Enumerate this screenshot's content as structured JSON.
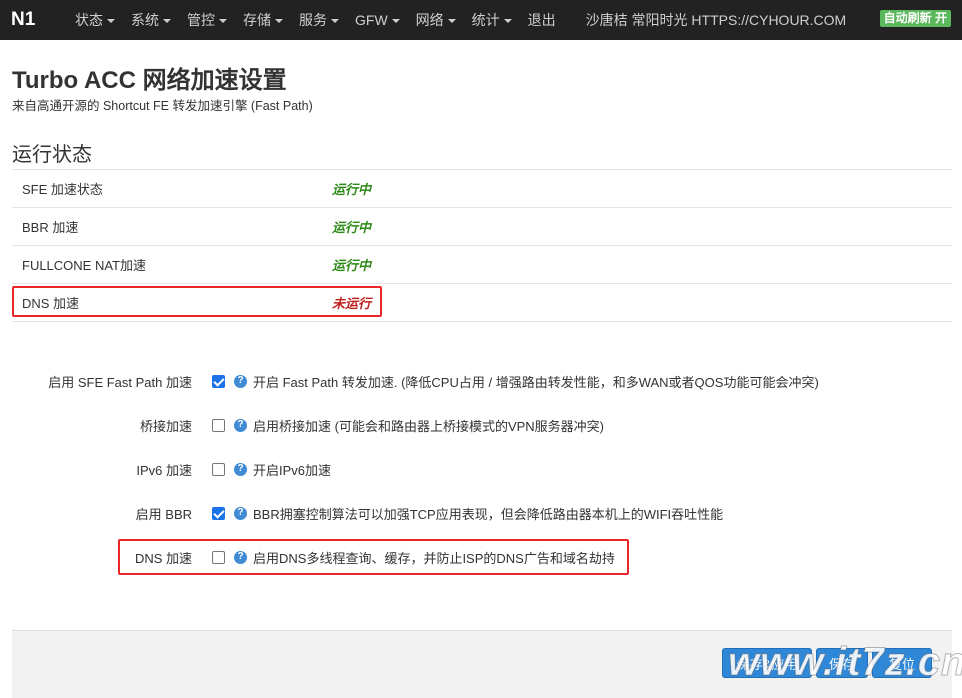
{
  "navbar": {
    "brand": "N1",
    "menu": [
      {
        "label": "状态"
      },
      {
        "label": "系统"
      },
      {
        "label": "管控"
      },
      {
        "label": "存储"
      },
      {
        "label": "服务"
      },
      {
        "label": "GFW"
      },
      {
        "label": "网络"
      },
      {
        "label": "统计"
      },
      {
        "label": "退出"
      }
    ],
    "host": "沙唐桔 常阳时光 HTTPS://CYHOUR.COM",
    "auto_refresh": "自动刷新 开",
    "accent_color": "#5cb85c"
  },
  "page": {
    "title": "Turbo ACC 网络加速设置",
    "description": "来自高通开源的 Shortcut FE 转发加速引擎 (Fast Path)"
  },
  "status": {
    "section_title": "运行状态",
    "rows": [
      {
        "label": "SFE 加速状态",
        "value": "运行中",
        "state": "ok"
      },
      {
        "label": "BBR 加速",
        "value": "运行中",
        "state": "ok"
      },
      {
        "label": "FULLCONE NAT加速",
        "value": "运行中",
        "state": "ok"
      },
      {
        "label": "DNS 加速",
        "value": "未运行",
        "state": "bad"
      }
    ],
    "ok_color": "#2e8b18",
    "bad_color": "#c0201d"
  },
  "options": [
    {
      "label": "启用 SFE Fast Path 加速",
      "checked": true,
      "desc": "开启 Fast Path 转发加速. (降低CPU占用 / 增强路由转发性能，和多WAN或者QOS功能可能会冲突)"
    },
    {
      "label": "桥接加速",
      "checked": false,
      "desc": "启用桥接加速 (可能会和路由器上桥接模式的VPN服务器冲突)"
    },
    {
      "label": "IPv6 加速",
      "checked": false,
      "desc": "开启IPv6加速"
    },
    {
      "label": "启用 BBR",
      "checked": true,
      "desc": "BBR拥塞控制算法可以加强TCP应用表现，但会降低路由器本机上的WIFI吞吐性能"
    },
    {
      "label": "DNS 加速",
      "checked": false,
      "desc": "启用DNS多线程查询、缓存，并防止ISP的DNS广告和域名劫持"
    }
  ],
  "help_icon": "question-icon",
  "actions": {
    "save_apply": "保存&应用",
    "save": "保存",
    "reset": "复位"
  },
  "watermark": "www.it7z.cn"
}
